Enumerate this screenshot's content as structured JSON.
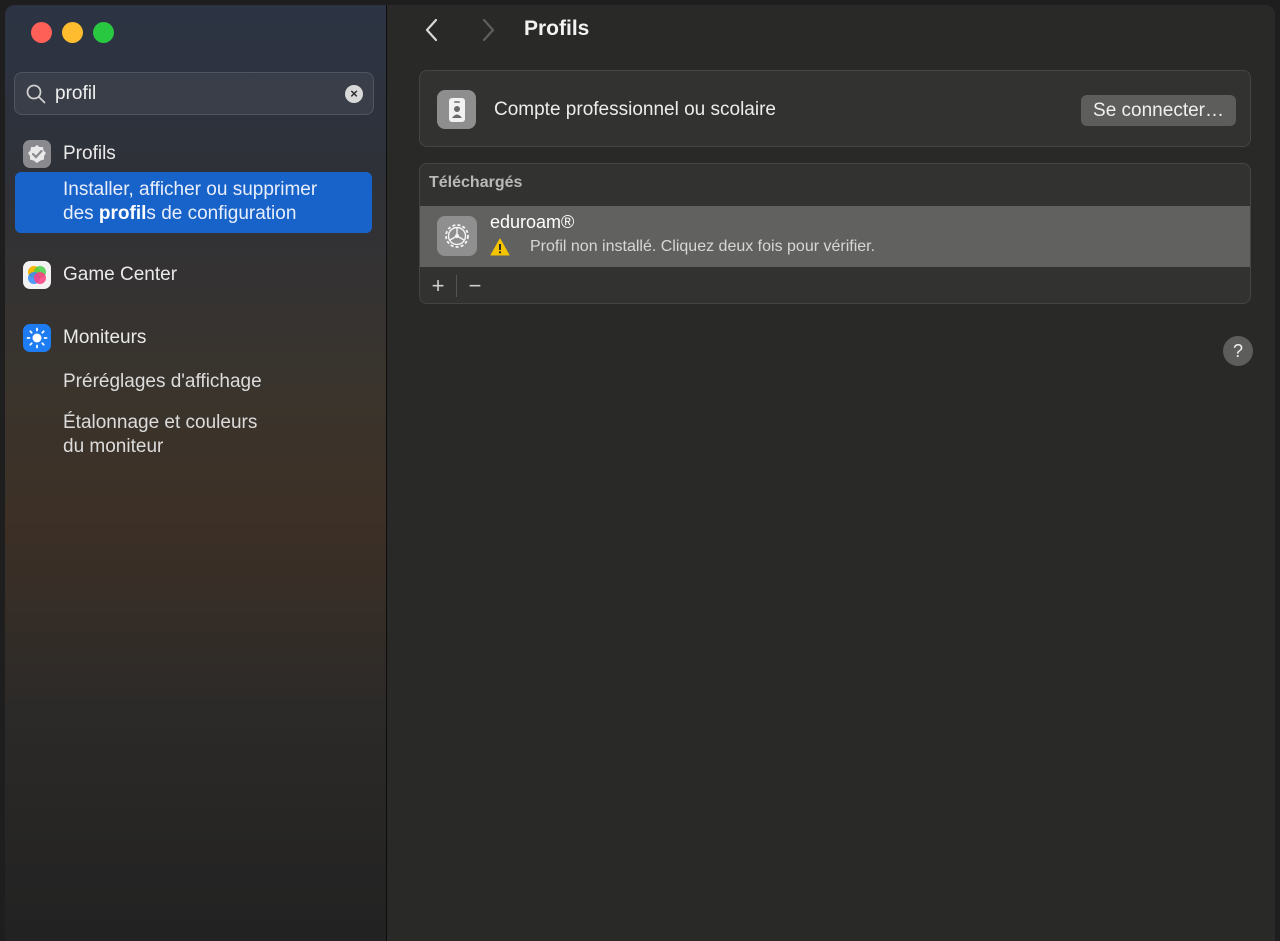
{
  "sidebar": {
    "search": {
      "value": "profil",
      "placeholder": ""
    },
    "items": [
      {
        "label": "Profils",
        "icon": "checkmark-badge-icon"
      },
      {
        "label": "Game Center",
        "icon": "game-center-icon"
      },
      {
        "label": "Moniteurs",
        "icon": "sun-icon"
      }
    ],
    "selected_result": {
      "line1": "Installer, afficher ou supprimer",
      "line2_prefix": "des ",
      "line2_bold": "profil",
      "line2_suffix": "s de configuration"
    },
    "monitor_subitems": [
      "Préréglages d'affichage",
      "Étalonnage et couleurs",
      "du moniteur"
    ]
  },
  "main": {
    "title": "Profils",
    "account": {
      "label": "Compte professionnel ou scolaire",
      "button": "Se connecter…"
    },
    "downloaded": {
      "header": "Téléchargés",
      "items": [
        {
          "name": "eduroam®",
          "status": "Profil non installé. Cliquez deux fois pour vérifier."
        }
      ]
    },
    "toolbar": {
      "add": "+",
      "remove": "−"
    },
    "help": "?"
  },
  "colors": {
    "accent": "#1863c9",
    "warning": "#f5c400"
  }
}
